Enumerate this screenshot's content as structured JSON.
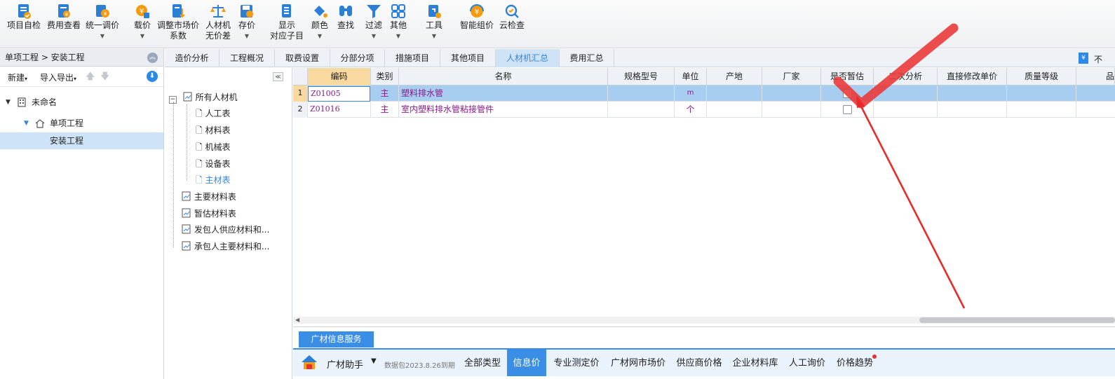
{
  "toolbar": {
    "items": [
      {
        "label": "项目自检",
        "icon": "project-check-icon",
        "caret": false
      },
      {
        "label": "费用查看",
        "icon": "cost-view-icon",
        "caret": false
      },
      {
        "label": "统一调价",
        "icon": "unified-price-icon",
        "caret": true
      },
      {
        "label": "载价",
        "icon": "load-price-icon",
        "caret": true
      },
      {
        "label": "调整市场价\n系数",
        "icon": "adjust-market-price-icon",
        "caret": false
      },
      {
        "label": "人材机\n无价差",
        "icon": "balance-scale-icon",
        "caret": false
      },
      {
        "label": "存价",
        "icon": "save-price-icon",
        "caret": true
      },
      {
        "label": "显示\n对应子目",
        "icon": "show-subitem-icon",
        "caret": false
      },
      {
        "label": "颜色",
        "icon": "paint-bucket-icon",
        "caret": true
      },
      {
        "label": "查找",
        "icon": "binoculars-icon",
        "caret": false
      },
      {
        "label": "过滤",
        "icon": "filter-icon",
        "caret": true
      },
      {
        "label": "其他",
        "icon": "grid-apps-icon",
        "caret": true
      },
      {
        "label": "工具",
        "icon": "tools-icon",
        "caret": true
      },
      {
        "label": "智能组价",
        "icon": "smart-pricing-icon",
        "caret": false
      },
      {
        "label": "云检查",
        "icon": "cloud-check-icon",
        "caret": false
      }
    ]
  },
  "left_panel": {
    "breadcrumb": "单项工程 > 安装工程",
    "toolbar": {
      "new_label": "新建",
      "import_export_label": "导入导出"
    },
    "tree": [
      {
        "label": "未命名",
        "level": 0,
        "icon": "building-icon"
      },
      {
        "label": "单项工程",
        "level": 1,
        "icon": "home-icon"
      },
      {
        "label": "安装工程",
        "level": 2,
        "icon": ""
      }
    ]
  },
  "tabs": {
    "items": [
      "造价分析",
      "工程概况",
      "取费设置",
      "分部分项",
      "措施项目",
      "其他项目",
      "人材机汇总",
      "费用汇总"
    ],
    "active_index": 6,
    "right_text": "不"
  },
  "material_tree": {
    "root": "所有人材机",
    "children": [
      "人工表",
      "材料表",
      "机械表",
      "设备表",
      "主材表"
    ],
    "active_child": "主材表",
    "others": [
      "主要材料表",
      "暂估材料表",
      "发包人供应材料和...",
      "承包人主要材料和..."
    ]
  },
  "grid": {
    "columns": [
      "编码",
      "类别",
      "名称",
      "规格型号",
      "单位",
      "产地",
      "厂家",
      "是否暂估",
      "二次分析",
      "直接修改单价",
      "质量等级",
      "品"
    ],
    "rows": [
      {
        "num": "1",
        "code": "Z01005",
        "type": "主",
        "name": "塑料排水管",
        "spec": "",
        "unit": "m",
        "origin": "",
        "maker": "",
        "provisional": false
      },
      {
        "num": "2",
        "code": "Z01016",
        "type": "主",
        "name": "室内塑料排水管粘接管件",
        "spec": "",
        "unit": "个",
        "origin": "",
        "maker": "",
        "provisional": false
      }
    ]
  },
  "bottom_panel": {
    "tab_label": "广材信息服务",
    "assistant_title": "广材助手",
    "data_package": "数据包2023.8.26到期",
    "tabs": [
      "全部类型",
      "信息价",
      "专业测定价",
      "广材网市场价",
      "供应商价格",
      "企业材料库",
      "人工询价",
      "价格趋势"
    ],
    "active_index": 1
  },
  "colors": {
    "accent": "#3a8ee6",
    "selected_row": "#a7cdf0",
    "code_text": "#8b1a8b",
    "annotation_red": "#e8312d"
  }
}
